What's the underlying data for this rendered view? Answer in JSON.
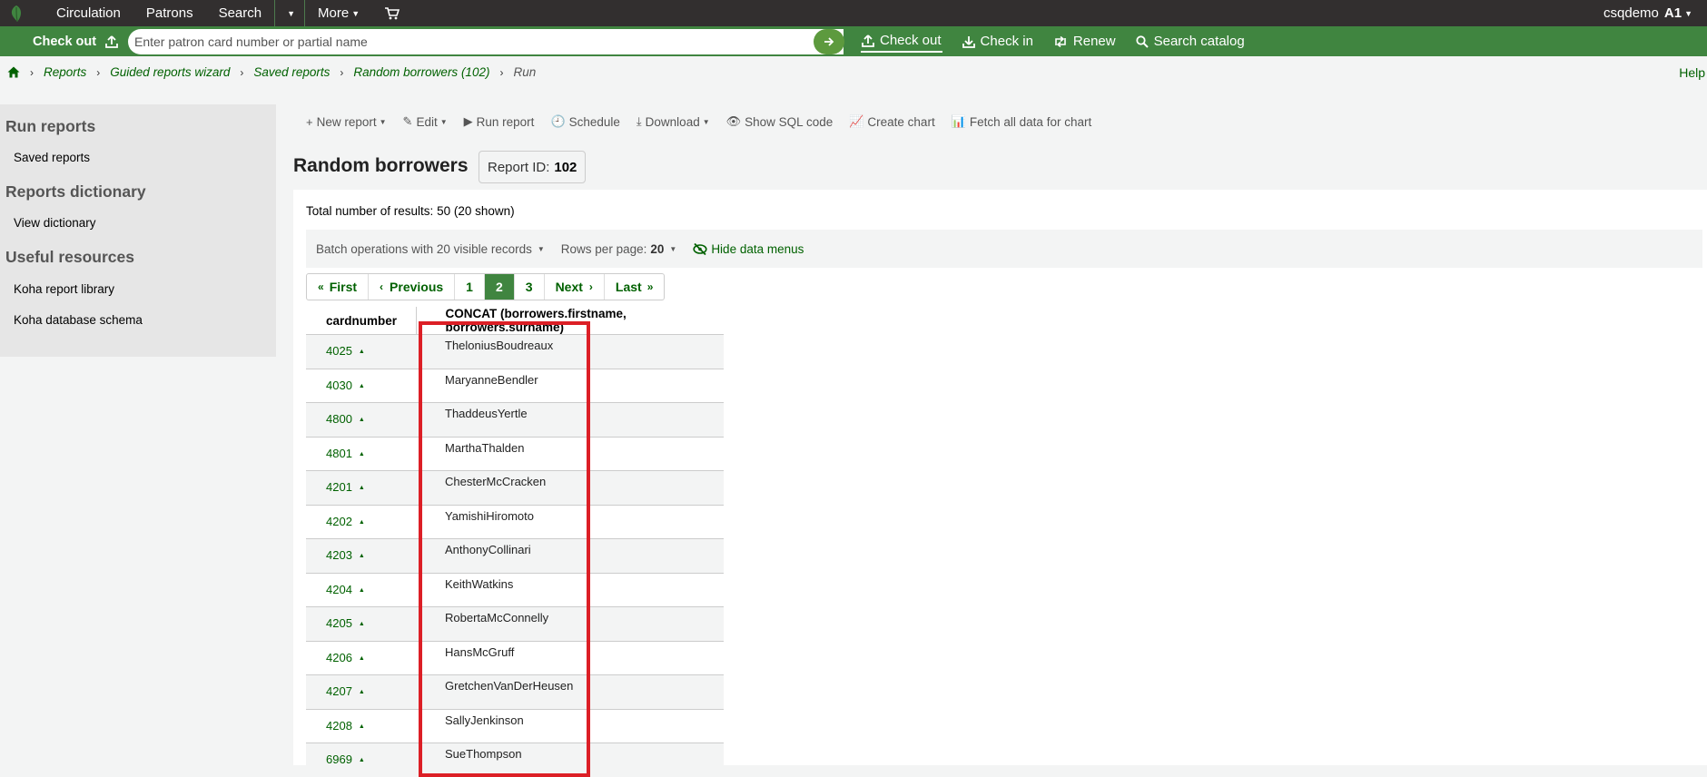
{
  "topnav": {
    "items": [
      "Circulation",
      "Patrons",
      "Search",
      "More"
    ],
    "user": "csqdemo",
    "branch": "A1"
  },
  "greenbar": {
    "checkout_label": "Check out",
    "search_placeholder": "Enter patron card number or partial name",
    "links": [
      "Check out",
      "Check in",
      "Renew",
      "Search catalog"
    ]
  },
  "breadcrumb": {
    "items": [
      "Reports",
      "Guided reports wizard",
      "Saved reports",
      "Random borrowers (102)"
    ],
    "current": "Run"
  },
  "help_label": "Help",
  "sidebar": {
    "sections": [
      {
        "heading": "Run reports",
        "links": [
          "Saved reports"
        ]
      },
      {
        "heading": "Reports dictionary",
        "links": [
          "View dictionary"
        ]
      },
      {
        "heading": "Useful resources",
        "links": [
          "Koha report library",
          "Koha database schema"
        ]
      }
    ]
  },
  "toolbar": {
    "new_report": "New report",
    "edit": "Edit",
    "run_report": "Run report",
    "schedule": "Schedule",
    "download": "Download",
    "show_sql": "Show SQL code",
    "create_chart": "Create chart",
    "fetch_all": "Fetch all data for chart"
  },
  "report": {
    "title": "Random borrowers",
    "id_label": "Report ID:",
    "id_value": "102",
    "totals": "Total number of results: 50 (20 shown)"
  },
  "batchbar": {
    "batch": "Batch operations with 20 visible records",
    "rows_label": "Rows per page:",
    "rows_value": "20",
    "hide_menus": "Hide data menus"
  },
  "pager": {
    "first": "First",
    "previous": "Previous",
    "pages": [
      "1",
      "2",
      "3"
    ],
    "active_page": "2",
    "next": "Next",
    "last": "Last"
  },
  "table": {
    "columns": [
      "cardnumber",
      "CONCAT (borrowers.firstname, borrowers.surname)"
    ],
    "rows": [
      [
        "4025",
        "TheloniusBoudreaux"
      ],
      [
        "4030",
        "MaryanneBendler"
      ],
      [
        "4800",
        "ThaddeusYertle"
      ],
      [
        "4801",
        "MarthaThalden"
      ],
      [
        "4201",
        "ChesterMcCracken"
      ],
      [
        "4202",
        "YamishiHiromoto"
      ],
      [
        "4203",
        "AnthonyCollinari"
      ],
      [
        "4204",
        "KeithWatkins"
      ],
      [
        "4205",
        "RobertaMcConnelly"
      ],
      [
        "4206",
        "HansMcGruff"
      ],
      [
        "4207",
        "GretchenVanDerHeusen"
      ],
      [
        "4208",
        "SallyJenkinson"
      ],
      [
        "6969",
        "SueThompson"
      ]
    ]
  },
  "colors": {
    "topnav_bg": "#322f2f",
    "green_bar": "#408540",
    "link_green": "#006100",
    "highlight_red": "#dc1f26"
  }
}
